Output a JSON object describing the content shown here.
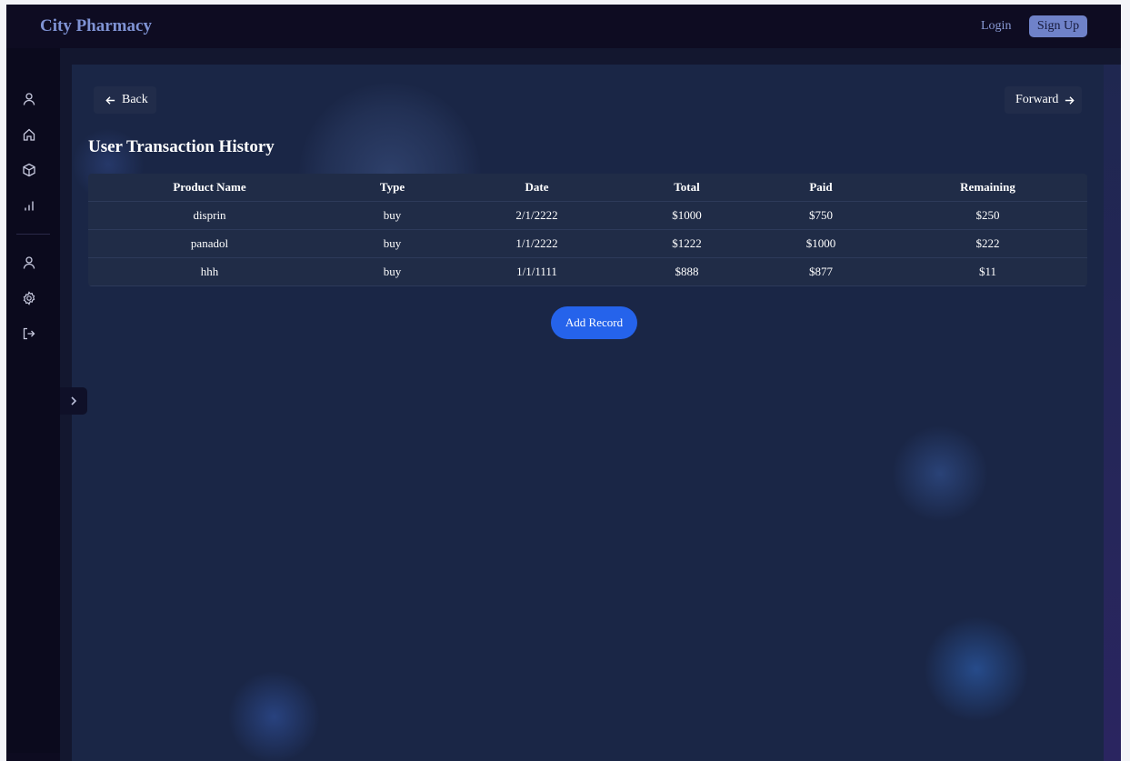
{
  "header": {
    "brand": "City Pharmacy",
    "login_label": "Login",
    "signup_label": "Sign Up"
  },
  "sidebar": {
    "items": [
      {
        "icon": "user-icon"
      },
      {
        "icon": "home-icon"
      },
      {
        "icon": "box-icon"
      },
      {
        "icon": "bar-chart-icon"
      },
      {
        "icon": "profile-icon"
      },
      {
        "icon": "gear-icon"
      },
      {
        "icon": "logout-icon"
      }
    ],
    "toggle_icon": "chevron-right-icon"
  },
  "nav": {
    "back_label": "Back",
    "forward_label": "Forward"
  },
  "page": {
    "title": "User Transaction History"
  },
  "table": {
    "columns": [
      "Product Name",
      "Type",
      "Date",
      "Total",
      "Paid",
      "Remaining"
    ],
    "rows": [
      [
        "disprin",
        "buy",
        "2/1/2222",
        "$1000",
        "$750",
        "$250"
      ],
      [
        "panadol",
        "buy",
        "1/1/2222",
        "$1222",
        "$1000",
        "$222"
      ],
      [
        "hhh",
        "buy",
        "1/1/1111",
        "$888",
        "$877",
        "$11"
      ]
    ]
  },
  "actions": {
    "add_record_label": "Add Record"
  },
  "colors": {
    "brand": "#7f93d4",
    "primary_button": "#2563eb",
    "content_bg": "#1a2646",
    "sidebar_bg": "#0b0a1d"
  }
}
